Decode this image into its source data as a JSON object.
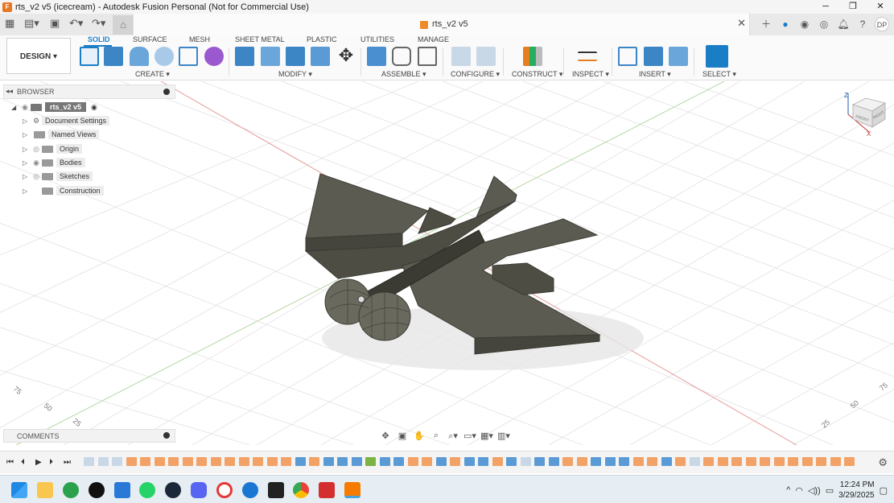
{
  "window": {
    "title": "rts_v2 v5 (icecream) - Autodesk Fusion Personal (Not for Commercial Use)",
    "minimize": "─",
    "restore": "❐",
    "close": "✕"
  },
  "document_tab": {
    "title": "rts_v2 v5",
    "close": "✕"
  },
  "user_initials": "DP",
  "ribbon": {
    "design_label": "DESIGN ▾",
    "tabs": [
      "SOLID",
      "SURFACE",
      "MESH",
      "SHEET METAL",
      "PLASTIC",
      "UTILITIES",
      "MANAGE"
    ],
    "groups": [
      "CREATE ▾",
      "MODIFY ▾",
      "ASSEMBLE ▾",
      "CONFIGURE ▾",
      "CONSTRUCT ▾",
      "INSPECT ▾",
      "INSERT ▾",
      "SELECT ▾"
    ]
  },
  "browser": {
    "title": "BROWSER",
    "root": "rts_v2 v5",
    "items": [
      "Document Settings",
      "Named Views",
      "Origin",
      "Bodies",
      "Sketches",
      "Construction"
    ]
  },
  "comments": {
    "title": "COMMENTS"
  },
  "grid_labels": [
    "75",
    "50",
    "25",
    "25",
    "50",
    "75"
  ],
  "viewcube": {
    "faces": [
      "FRONT",
      "RIGHT"
    ],
    "axes": [
      "Z",
      "X"
    ]
  },
  "taskbar": {
    "time": "12:24 PM",
    "date": "3/29/2025"
  },
  "colors": {
    "accent": "#1a7ec7",
    "model_body": "#5c5b51",
    "model_dark": "#3b3a33",
    "grid": "#dcdcdc",
    "axis_red": "#e06666",
    "axis_green": "#93c47d",
    "timeline_orange": "#f2a266",
    "timeline_blue": "#5b9bd5"
  }
}
